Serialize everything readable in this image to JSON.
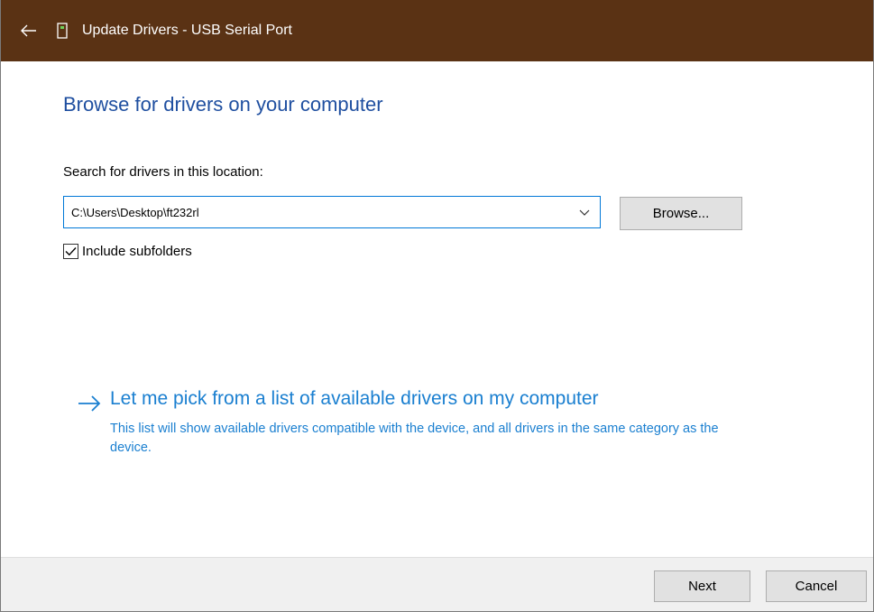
{
  "colors": {
    "titlebar_bg": "#5a3214",
    "heading": "#1f4fa0",
    "link": "#1a7fd0",
    "accent_border": "#0078d7"
  },
  "titlebar": {
    "back_icon": "back-arrow-icon",
    "device_icon": "usb-device-icon",
    "title": "Update Drivers - USB Serial Port"
  },
  "main": {
    "heading": "Browse for drivers on your computer",
    "search_label": "Search for drivers in this location:",
    "path_value": "C:\\Users\\Desktop\\ft232rl",
    "browse_label": "Browse...",
    "subfolders_label": "Include subfolders",
    "subfolders_checked": true,
    "pick_link": "Let me pick from a list of available drivers on my computer",
    "pick_description": "This list will show available drivers compatible with the device, and all drivers in the same category as the device."
  },
  "footer": {
    "next_label": "Next",
    "cancel_label": "Cancel"
  }
}
